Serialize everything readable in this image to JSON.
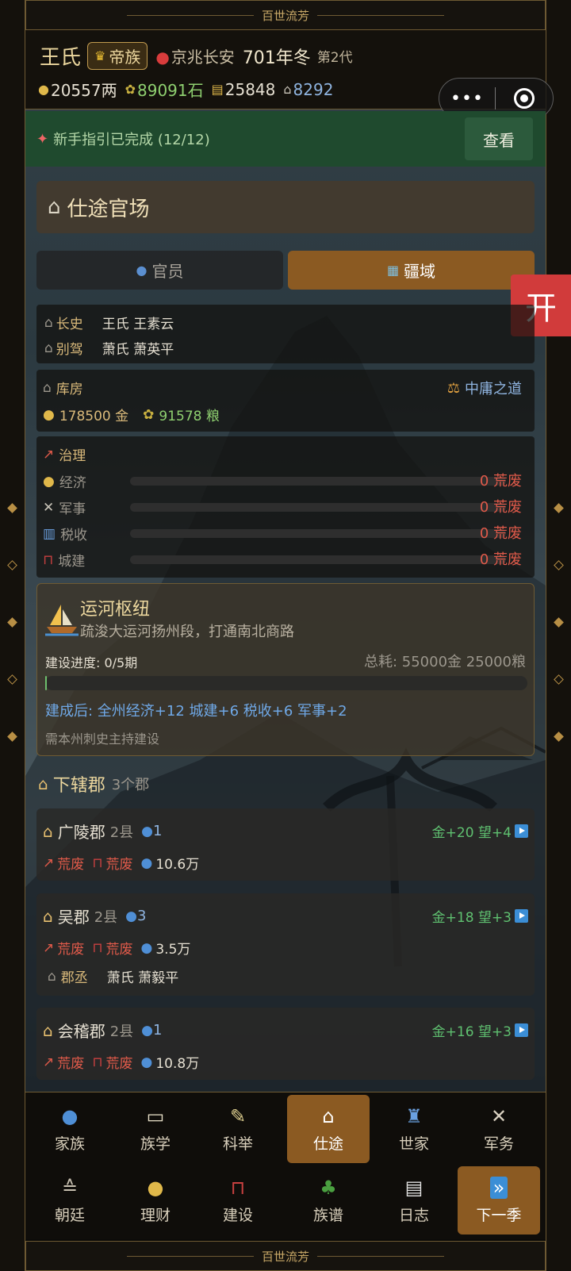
{
  "frame": {
    "title_top": "百世流芳",
    "title_bottom": "百世流芳"
  },
  "header": {
    "clan": "王氏",
    "rank": "帝族",
    "location": "京兆长安",
    "year": "701年冬",
    "generation": "第2代",
    "resources": {
      "money": "20557两",
      "grain": "89091石",
      "scroll": "25848",
      "prestige": "8292"
    }
  },
  "guide": {
    "text": "新手指引已完成 (12/12)",
    "button": "查看"
  },
  "section": {
    "title": "仕途官场"
  },
  "tabs": {
    "officials": "官员",
    "territory": "疆域"
  },
  "open_button": "开",
  "officers": [
    {
      "role": "长史",
      "name": "王氏 王素云"
    },
    {
      "role": "别驾",
      "name": "萧氏 萧英平"
    }
  ],
  "treasury": {
    "label": "库房",
    "policy": "中庸之道",
    "gold": "178500 金",
    "grain": "91578 粮"
  },
  "governance": {
    "title": "治理",
    "items": [
      {
        "label": "经济",
        "value": "0 荒废",
        "level": 0
      },
      {
        "label": "军事",
        "value": "0 荒废",
        "level": 0
      },
      {
        "label": "税收",
        "value": "0 荒废",
        "level": 0
      },
      {
        "label": "城建",
        "value": "0 荒废",
        "level": 0
      }
    ]
  },
  "project": {
    "title": "运河枢纽",
    "desc": "疏浚大运河扬州段，打通南北商路",
    "progress_label": "建设进度: 0/5期",
    "progress": 0,
    "cost": "总耗: 55000金 25000粮",
    "effect": "建成后: 全州经济+12 城建+6 税收+6 军事+2",
    "note": "需本州刺史主持建设"
  },
  "commanderies": {
    "title": "下辖郡",
    "count": "3个郡",
    "items": [
      {
        "name": "广陵郡",
        "counties": "2县",
        "people": "1",
        "yield": "金+20 望+4",
        "econ": "荒废",
        "build": "荒废",
        "pop": "10.6万"
      },
      {
        "name": "吴郡",
        "counties": "2县",
        "people": "3",
        "yield": "金+18 望+3",
        "econ": "荒废",
        "build": "荒废",
        "pop": "3.5万",
        "aide_role": "郡丞",
        "aide_name": "萧氏 萧毅平"
      },
      {
        "name": "会稽郡",
        "counties": "2县",
        "people": "1",
        "yield": "金+16 望+3",
        "econ": "荒废",
        "build": "荒废",
        "pop": "10.8万"
      }
    ]
  },
  "nav": {
    "row1": [
      "家族",
      "族学",
      "科举",
      "仕途",
      "世家",
      "军务"
    ],
    "row2": [
      "朝廷",
      "理财",
      "建设",
      "族谱",
      "日志",
      "下一季"
    ]
  }
}
